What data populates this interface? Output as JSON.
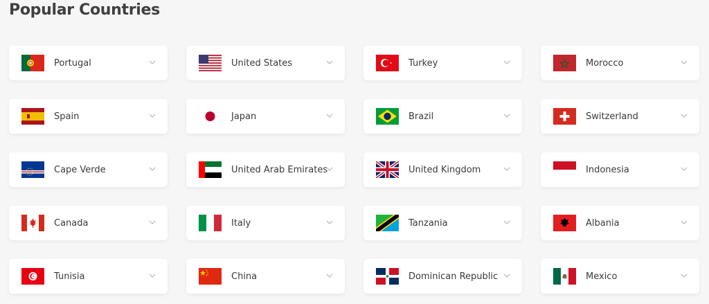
{
  "page": {
    "title": "Popular Countries"
  },
  "countries": [
    {
      "name": "Portugal",
      "flag": "portugal-flag"
    },
    {
      "name": "United States",
      "flag": "usa-flag"
    },
    {
      "name": "Turkey",
      "flag": "turkey-flag"
    },
    {
      "name": "Morocco",
      "flag": "morocco-flag"
    },
    {
      "name": "Spain",
      "flag": "spain-flag"
    },
    {
      "name": "Japan",
      "flag": "japan-flag"
    },
    {
      "name": "Brazil",
      "flag": "brazil-flag"
    },
    {
      "name": "Switzerland",
      "flag": "switzerland-flag"
    },
    {
      "name": "Cape Verde",
      "flag": "cape-verde-flag"
    },
    {
      "name": "United Arab Emirates",
      "flag": "uae-flag"
    },
    {
      "name": "United Kingdom",
      "flag": "uk-flag"
    },
    {
      "name": "Indonesia",
      "flag": "indonesia-flag"
    },
    {
      "name": "Canada",
      "flag": "canada-flag"
    },
    {
      "name": "Italy",
      "flag": "italy-flag"
    },
    {
      "name": "Tanzania",
      "flag": "tanzania-flag"
    },
    {
      "name": "Albania",
      "flag": "albania-flag"
    },
    {
      "name": "Tunisia",
      "flag": "tunisia-flag"
    },
    {
      "name": "China",
      "flag": "china-flag"
    },
    {
      "name": "Dominican Republic",
      "flag": "dominican-republic-flag"
    },
    {
      "name": "Mexico",
      "flag": "mexico-flag"
    }
  ]
}
